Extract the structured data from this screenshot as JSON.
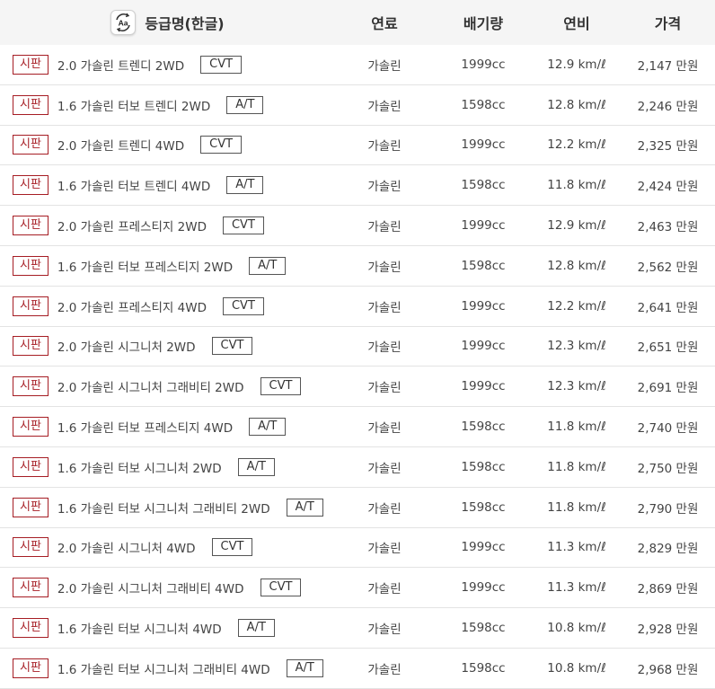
{
  "header": {
    "icon": "aa-language-icon",
    "icon_text": "Aa",
    "grade": "등급명(한글)",
    "fuel": "연료",
    "displacement": "배기량",
    "efficiency": "연비",
    "price": "가격"
  },
  "colors": {
    "badge": "#a61d24",
    "header_bg": "#f5f5f5",
    "divider": "#e3e3e3"
  },
  "rows": [
    {
      "badge": "시판",
      "name": "2.0 가솔린 트렌디 2WD",
      "trans": "CVT",
      "fuel": "가솔린",
      "displacement": "1999cc",
      "efficiency": "12.9 km/ℓ",
      "price": "2,147 만원"
    },
    {
      "badge": "시판",
      "name": "1.6 가솔린 터보 트렌디 2WD",
      "trans": "A/T",
      "fuel": "가솔린",
      "displacement": "1598cc",
      "efficiency": "12.8 km/ℓ",
      "price": "2,246 만원"
    },
    {
      "badge": "시판",
      "name": "2.0 가솔린 트렌디 4WD",
      "trans": "CVT",
      "fuel": "가솔린",
      "displacement": "1999cc",
      "efficiency": "12.2 km/ℓ",
      "price": "2,325 만원"
    },
    {
      "badge": "시판",
      "name": "1.6 가솔린 터보 트렌디 4WD",
      "trans": "A/T",
      "fuel": "가솔린",
      "displacement": "1598cc",
      "efficiency": "11.8 km/ℓ",
      "price": "2,424 만원"
    },
    {
      "badge": "시판",
      "name": "2.0 가솔린 프레스티지 2WD",
      "trans": "CVT",
      "fuel": "가솔린",
      "displacement": "1999cc",
      "efficiency": "12.9 km/ℓ",
      "price": "2,463 만원"
    },
    {
      "badge": "시판",
      "name": "1.6 가솔린 터보 프레스티지 2WD",
      "trans": "A/T",
      "fuel": "가솔린",
      "displacement": "1598cc",
      "efficiency": "12.8 km/ℓ",
      "price": "2,562 만원"
    },
    {
      "badge": "시판",
      "name": "2.0 가솔린 프레스티지 4WD",
      "trans": "CVT",
      "fuel": "가솔린",
      "displacement": "1999cc",
      "efficiency": "12.2 km/ℓ",
      "price": "2,641 만원"
    },
    {
      "badge": "시판",
      "name": "2.0 가솔린 시그니처 2WD",
      "trans": "CVT",
      "fuel": "가솔린",
      "displacement": "1999cc",
      "efficiency": "12.3 km/ℓ",
      "price": "2,651 만원"
    },
    {
      "badge": "시판",
      "name": "2.0 가솔린 시그니처 그래비티 2WD",
      "trans": "CVT",
      "fuel": "가솔린",
      "displacement": "1999cc",
      "efficiency": "12.3 km/ℓ",
      "price": "2,691 만원"
    },
    {
      "badge": "시판",
      "name": "1.6 가솔린 터보 프레스티지 4WD",
      "trans": "A/T",
      "fuel": "가솔린",
      "displacement": "1598cc",
      "efficiency": "11.8 km/ℓ",
      "price": "2,740 만원"
    },
    {
      "badge": "시판",
      "name": "1.6 가솔린 터보 시그니처 2WD",
      "trans": "A/T",
      "fuel": "가솔린",
      "displacement": "1598cc",
      "efficiency": "11.8 km/ℓ",
      "price": "2,750 만원"
    },
    {
      "badge": "시판",
      "name": "1.6 가솔린 터보 시그니처 그래비티 2WD",
      "trans": "A/T",
      "fuel": "가솔린",
      "displacement": "1598cc",
      "efficiency": "11.8 km/ℓ",
      "price": "2,790 만원"
    },
    {
      "badge": "시판",
      "name": "2.0 가솔린 시그니처 4WD",
      "trans": "CVT",
      "fuel": "가솔린",
      "displacement": "1999cc",
      "efficiency": "11.3 km/ℓ",
      "price": "2,829 만원"
    },
    {
      "badge": "시판",
      "name": "2.0 가솔린 시그니처 그래비티 4WD",
      "trans": "CVT",
      "fuel": "가솔린",
      "displacement": "1999cc",
      "efficiency": "11.3 km/ℓ",
      "price": "2,869 만원"
    },
    {
      "badge": "시판",
      "name": "1.6 가솔린 터보 시그니처 4WD",
      "trans": "A/T",
      "fuel": "가솔린",
      "displacement": "1598cc",
      "efficiency": "10.8 km/ℓ",
      "price": "2,928 만원"
    },
    {
      "badge": "시판",
      "name": "1.6 가솔린 터보 시그니처 그래비티 4WD",
      "trans": "A/T",
      "fuel": "가솔린",
      "displacement": "1598cc",
      "efficiency": "10.8 km/ℓ",
      "price": "2,968 만원"
    }
  ]
}
